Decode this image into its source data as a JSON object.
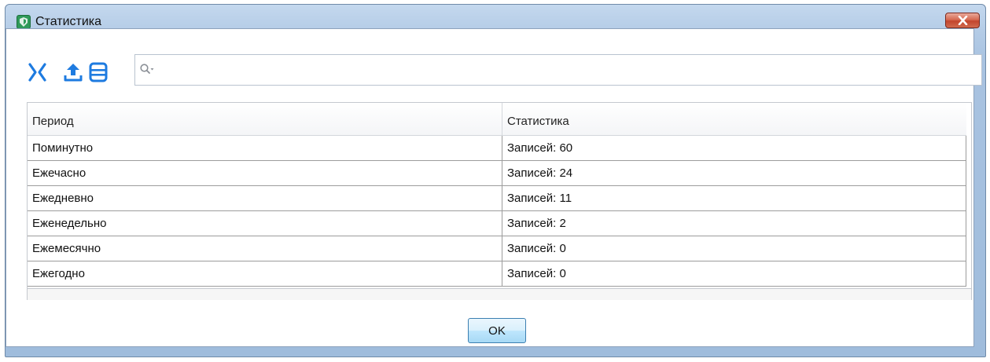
{
  "window": {
    "title": "Статистика",
    "close_label": "x"
  },
  "toolbar": {
    "icons": [
      "collapse-expand-icon",
      "export-upload-icon",
      "list-icon"
    ],
    "search": {
      "value": "",
      "placeholder": ""
    }
  },
  "table": {
    "columns": [
      "Период",
      "Статистика"
    ],
    "rows": [
      [
        "Поминутно",
        "Записей: 60"
      ],
      [
        "Ежечасно",
        "Записей: 24"
      ],
      [
        "Ежедневно",
        "Записей: 11"
      ],
      [
        "Еженедельно",
        "Записей: 2"
      ],
      [
        "Ежемесячно",
        "Записей: 0"
      ],
      [
        "Ежегодно",
        "Записей: 0"
      ]
    ]
  },
  "footer": {
    "ok_label": "OK"
  },
  "colors": {
    "accent": "#1e7be0",
    "titlebar": "#b3cbe6",
    "close": "#c2452d"
  }
}
